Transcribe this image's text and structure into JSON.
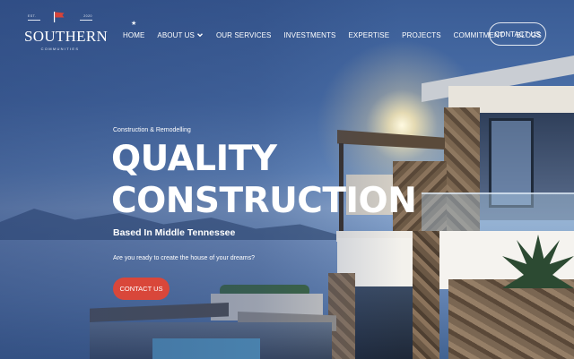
{
  "brand": {
    "name": "SOUTHERN",
    "tagline": "COMMUNITIES",
    "est_label": "EST.",
    "est_year": "2020",
    "flag_color": "#d64339"
  },
  "nav": {
    "items": [
      {
        "label": "HOME",
        "active": true
      },
      {
        "label": "ABOUT US",
        "has_dropdown": true
      },
      {
        "label": "OUR SERVICES"
      },
      {
        "label": "INVESTMENTS"
      },
      {
        "label": "EXPERTISE"
      },
      {
        "label": "PROJECTS"
      },
      {
        "label": "COMMITMENT"
      },
      {
        "label": "BLOGS"
      }
    ],
    "active_marker_icon": "star-icon",
    "cta_label": "CONTACT US"
  },
  "hero": {
    "kicker": "Construction & Remodelling",
    "headline_line1": "QUALITY",
    "headline_line2": "CONSTRUCTION",
    "location": "Based In Middle Tennessee",
    "lead": "Are you ready to create the house of your dreams?",
    "cta_label": "CONTACT US",
    "cta_color": "#d9473a"
  }
}
